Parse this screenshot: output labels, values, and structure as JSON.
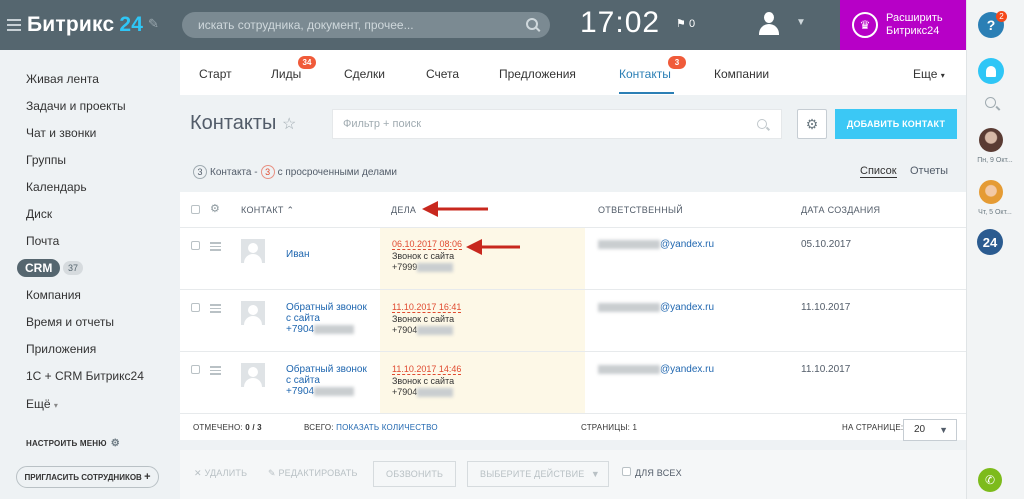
{
  "header": {
    "logo_text": "Битрикс",
    "logo_num": "24",
    "search_placeholder": "искать сотрудника, документ, прочее...",
    "clock": "17:02",
    "flag_count": "0",
    "expand_line1": "Расширить",
    "expand_line2": "Битрикс24"
  },
  "rightbar": {
    "help_label": "?",
    "help_badge": "2",
    "user1_label": "Пн, 9 Окт...",
    "user2_label": "Чт, 5 Окт...",
    "b24_label": "24"
  },
  "sidebar": {
    "items": [
      "Живая лента",
      "Задачи и проекты",
      "Чат и звонки",
      "Группы",
      "Календарь",
      "Диск",
      "Почта"
    ],
    "crm_label": "CRM",
    "crm_count": "37",
    "items2": [
      "Компания",
      "Время и отчеты",
      "Приложения",
      "1С + CRM Битрикс24",
      "Ещё"
    ],
    "setup_menu": "НАСТРОИТЬ МЕНЮ",
    "invite": "ПРИГЛАСИТЬ СОТРУДНИКОВ"
  },
  "tabs": {
    "items": [
      {
        "label": "Старт"
      },
      {
        "label": "Лиды",
        "badge": "34"
      },
      {
        "label": "Сделки"
      },
      {
        "label": "Счета"
      },
      {
        "label": "Предложения"
      },
      {
        "label": "Контакты",
        "badge": "3",
        "active": true
      },
      {
        "label": "Компании"
      }
    ],
    "more": "Еще"
  },
  "page": {
    "title": "Контакты",
    "filter_placeholder": "Фильтр + поиск",
    "add_button": "ДОБАВИТЬ КОНТАКТ",
    "summary_count": "3",
    "summary_text1": "Контакта -",
    "summary_overdue": "3",
    "summary_text2": "с просроченными делами",
    "view_list": "Список",
    "view_reports": "Отчеты"
  },
  "table": {
    "headers": {
      "contact": "КОНТАКТ",
      "deals": "ДЕЛА",
      "responsible": "ОТВЕТСТВЕННЫЙ",
      "created": "ДАТА СОЗДАНИЯ"
    },
    "rows": [
      {
        "name_lines": [
          "Иван"
        ],
        "deal_date": "06.10.2017 08:06",
        "deal_type": "Звонок с сайта",
        "deal_phone": "+7999",
        "email_suffix": "@yandex.ru",
        "created": "05.10.2017"
      },
      {
        "name_lines": [
          "Обратный звонок",
          "с сайта",
          "+7904"
        ],
        "deal_date": "11.10.2017 16:41",
        "deal_type": "Звонок с сайта",
        "deal_phone": "+7904",
        "email_suffix": "@yandex.ru",
        "created": "11.10.2017"
      },
      {
        "name_lines": [
          "Обратный звонок",
          "с сайта",
          "+7904"
        ],
        "deal_date": "11.10.2017 14:46",
        "deal_type": "Звонок с сайта",
        "deal_phone": "+7904",
        "email_suffix": "@yandex.ru",
        "created": "11.10.2017"
      }
    ],
    "footer": {
      "selected_label": "ОТМЕЧЕНО:",
      "selected_value": "0 / 3",
      "total_label": "ВСЕГО:",
      "total_link": "ПОКАЗАТЬ КОЛИЧЕСТВО",
      "pages_label": "СТРАНИЦЫ:",
      "pages_value": "1",
      "per_page_label": "НА СТРАНИЦЕ:",
      "per_page_value": "20"
    }
  },
  "actions": {
    "delete": "УДАЛИТЬ",
    "edit": "РЕДАКТИРОВАТЬ",
    "call": "ОБЗВОНИТЬ",
    "choose": "ВЫБЕРИТЕ ДЕЙСТВИЕ",
    "for_all": "ДЛЯ ВСЕХ"
  },
  "colors": {
    "header_bg": "#55666f",
    "accent": "#2fc6f6",
    "expand_bg": "#b700c7",
    "badge": "#f05b3a",
    "link": "#2067b0",
    "overdue": "#e04b31",
    "arrow": "#c8281e"
  }
}
